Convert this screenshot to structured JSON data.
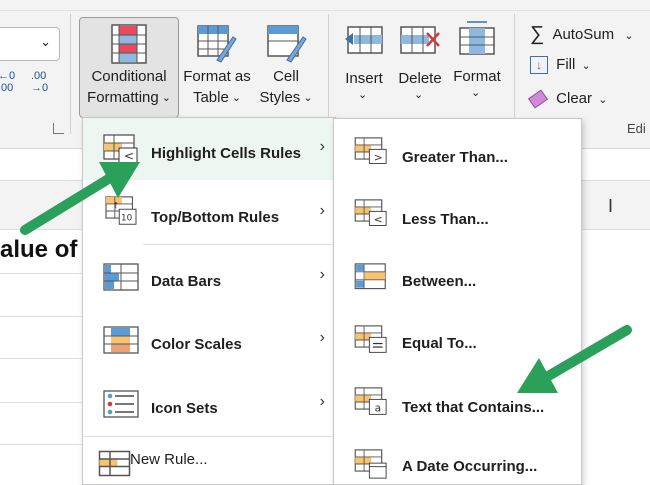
{
  "ribbon": {
    "conditional_formatting": {
      "line1": "Conditional",
      "line2": "Formatting"
    },
    "format_as_table": {
      "line1": "Format as",
      "line2": "Table"
    },
    "cell_styles": {
      "line1": "Cell",
      "line2": "Styles"
    },
    "insert": "Insert",
    "delete": "Delete",
    "format": "Format",
    "autosum": "AutoSum",
    "fill": "Fill",
    "clear": "Clear",
    "editing_group": "Edi",
    "dec_left": ".00",
    "dec_left_sub": "0",
    "dec_right_top": ".00",
    "dec_right_sub": "0",
    "sigma": "∑"
  },
  "sheet": {
    "cell_text": "alue of",
    "col_marker": "I"
  },
  "menu_main": {
    "items": [
      {
        "label": "Highlight Cells Rules",
        "icon": "highlight-cells-icon"
      },
      {
        "label": "Top/Bottom Rules",
        "icon": "top-bottom-icon"
      },
      {
        "label": "Data Bars",
        "icon": "data-bars-icon"
      },
      {
        "label": "Color Scales",
        "icon": "color-scales-icon"
      },
      {
        "label": "Icon Sets",
        "icon": "icon-sets-icon"
      }
    ],
    "new_rule": "New Rule..."
  },
  "menu_sub": {
    "items": [
      {
        "label": "Greater Than...",
        "icon": "greater-than-icon"
      },
      {
        "label": "Less Than...",
        "icon": "less-than-icon"
      },
      {
        "label": "Between...",
        "icon": "between-icon"
      },
      {
        "label": "Equal To...",
        "icon": "equal-to-icon"
      },
      {
        "label": "Text that Contains...",
        "icon": "text-contains-icon"
      },
      {
        "label": "A Date Occurring...",
        "icon": "date-occurring-icon"
      }
    ]
  },
  "colors": {
    "accent_green": "#2aa05a",
    "highlight_row": "#eef6f1",
    "icon_orange": "#f8c26e",
    "icon_blue": "#5b9bd5"
  }
}
